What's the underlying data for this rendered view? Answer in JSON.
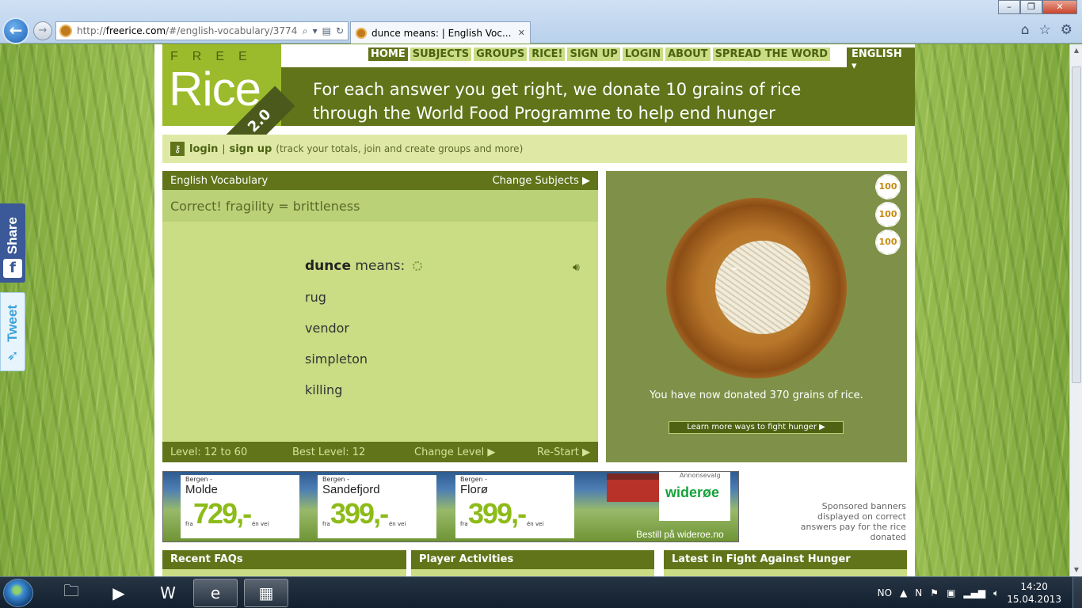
{
  "browser": {
    "window_buttons": [
      "–",
      "❐",
      "✕"
    ],
    "url_prefix": "http://",
    "url_host": "freerice.com",
    "url_rest": "/#/english-vocabulary/3774",
    "tab_title": "dunce means: | English Voc...",
    "tab_close": "✕"
  },
  "social": {
    "share": "Share",
    "share_icon": "f",
    "tweet": "Tweet"
  },
  "logo": {
    "free": "FREE",
    "rice": "Rice",
    "version": "2.0"
  },
  "nav": {
    "items": [
      "HOME",
      "SUBJECTS",
      "GROUPS",
      "RICE!",
      "SIGN UP",
      "LOGIN",
      "ABOUT",
      "SPREAD THE WORD"
    ],
    "language": "ENGLISH ▾"
  },
  "banner": {
    "line1": "For each answer you get right, we donate 10 grains of rice",
    "line2": "through the World Food Programme to help end hunger"
  },
  "loginbar": {
    "login": "login",
    "sep": "|",
    "signup": "sign up",
    "hint": "(track your totals, join and create groups and more)"
  },
  "quiz": {
    "subject": "English Vocabulary",
    "change_subjects": "Change Subjects ▶",
    "result": "Correct! fragility = brittleness",
    "word": "dunce",
    "means": "means:",
    "answers": [
      "rug",
      "vendor",
      "simpleton",
      "killing"
    ],
    "level": "Level: 12 to 60",
    "best_level": "Best Level: 12",
    "change_level": "Change Level ▶",
    "restart": "Re-Start ▶"
  },
  "rice": {
    "coins": [
      "100",
      "100",
      "100"
    ],
    "donated": "You have now donated 370 grains of rice.",
    "learn_more": "Learn more ways to fight hunger ▶"
  },
  "ad": {
    "cards": [
      {
        "from": "Bergen -",
        "city": "Molde",
        "price": "729,-",
        "fra": "fra",
        "vei": "én vei"
      },
      {
        "from": "Bergen -",
        "city": "Sandefjord",
        "price": "399,-",
        "fra": "fra",
        "vei": "én vei"
      },
      {
        "from": "Bergen -",
        "city": "Florø",
        "price": "399,-",
        "fra": "fra",
        "vei": "én vei"
      }
    ],
    "choices": "Annonsevalg",
    "brand": "widerøe",
    "cta": "Bestill på wideroe.no"
  },
  "sponsor_note": "Sponsored banners displayed on correct answers pay for the rice donated",
  "bottom_panels": [
    "Recent FAQs",
    "Player Activities",
    "Latest in Fight Against Hunger"
  ],
  "taskbar": {
    "lang": "NO",
    "time": "14:20",
    "date": "15.04.2013"
  }
}
